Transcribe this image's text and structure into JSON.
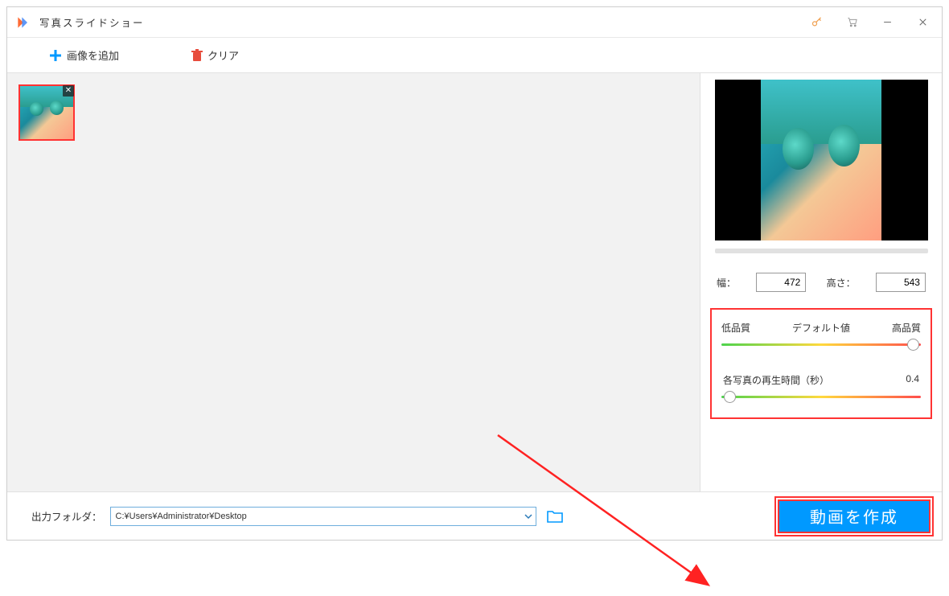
{
  "window": {
    "title": "写真スライドショー"
  },
  "toolbar": {
    "add_image": "画像を追加",
    "clear": "クリア"
  },
  "dims": {
    "width_label": "幅：",
    "width_value": "472",
    "height_label": "高さ：",
    "height_value": "543"
  },
  "quality": {
    "low": "低品質",
    "default": "デフォルト値",
    "high": "高品質",
    "slider_pct": 96
  },
  "duration": {
    "label": "各写真の再生時間（秒）",
    "value": "0.4",
    "slider_pct": 4
  },
  "output": {
    "label": "出力フォルダ：",
    "path": "C:¥Users¥Administrator¥Desktop"
  },
  "create_button": "動画を作成"
}
